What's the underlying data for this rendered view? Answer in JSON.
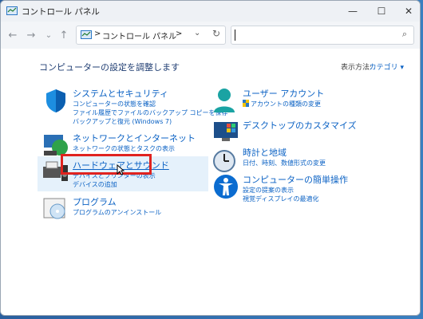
{
  "window": {
    "title": "コントロール パネル",
    "buttons": {
      "minimize": "—",
      "maximize": "☐",
      "close": "✕"
    }
  },
  "nav": {
    "back": "←",
    "forward": "→",
    "recent": "⌄",
    "up": "↑"
  },
  "address": {
    "sep1": ">",
    "crumb": "コントロール パネル",
    "sep2": ">",
    "dropdown": "⌄",
    "refresh": "↻"
  },
  "search": {
    "placeholder": ""
  },
  "heading": "コンピューターの設定を調整します",
  "view_by": {
    "label": "表示方法:",
    "value": "カテゴリ ▾"
  },
  "categories_left": [
    {
      "title": "システムとセキュリティ",
      "links": [
        "コンピューターの状態を確認",
        "ファイル履歴でファイルのバックアップ コピーを保存",
        "バックアップと復元 (Windows 7)"
      ]
    },
    {
      "title": "ネットワークとインターネット",
      "links": [
        "ネットワークの状態とタスクの表示"
      ]
    },
    {
      "title": "ハードウェアとサウンド",
      "links": [
        "デバイスとプリンターの表示",
        "デバイスの追加"
      ]
    },
    {
      "title": "プログラム",
      "links": [
        "プログラムのアンインストール"
      ]
    }
  ],
  "categories_right": [
    {
      "title": "ユーザー アカウント",
      "links": [
        "アカウントの種類の変更"
      ]
    },
    {
      "title": "デスクトップのカスタマイズ",
      "links": []
    },
    {
      "title": "時計と地域",
      "links": [
        "日付、時刻、数値形式の変更"
      ]
    },
    {
      "title": "コンピューターの簡単操作",
      "links": [
        "設定の提案の表示",
        "視覚ディスプレイの最適化"
      ]
    }
  ],
  "colors": {
    "link": "#0b62c4",
    "heading": "#1f3d72",
    "highlight": "#e0231f",
    "hover": "#e5f1fb"
  }
}
